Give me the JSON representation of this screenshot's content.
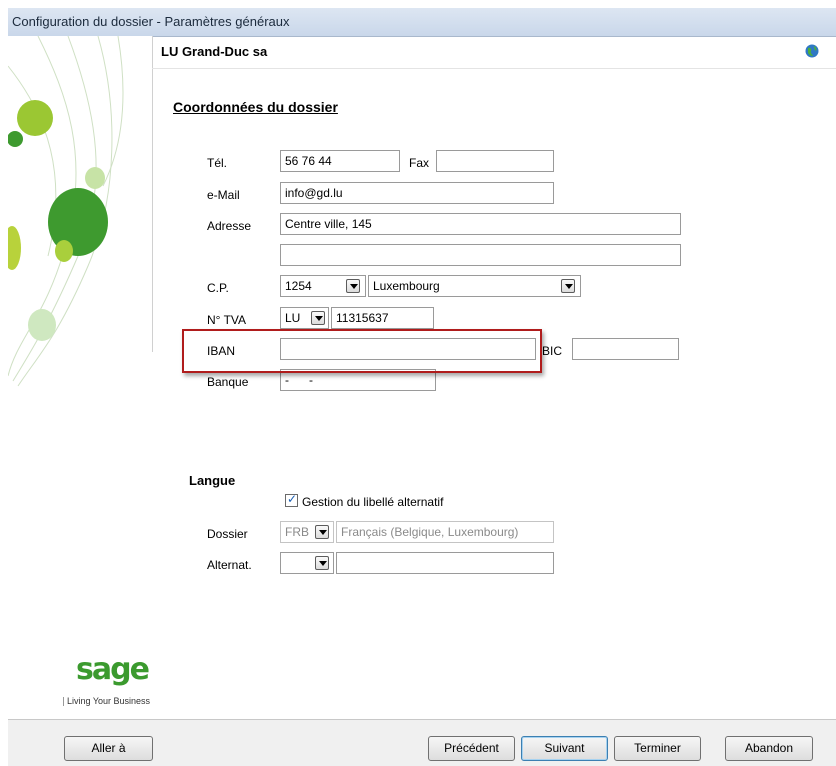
{
  "window": {
    "title": "Configuration du dossier - Paramètres généraux"
  },
  "header": {
    "company": "LU Grand-Duc sa",
    "icon": "globe-icon"
  },
  "coords": {
    "section_title": "Coordonnées du dossier",
    "tel_label": "Tél.",
    "tel_value": "56 76 44",
    "fax_label": "Fax",
    "fax_value": "",
    "email_label": "e-Mail",
    "email_value": "info@gd.lu",
    "adresse_label": "Adresse",
    "adresse_line1": "Centre ville, 145",
    "adresse_line2": "",
    "cp_label": "C.P.",
    "cp_value": "1254",
    "city_value": "Luxembourg",
    "tva_label": "N° TVA",
    "tva_country": "LU",
    "tva_number": "11315637",
    "iban_label": "IBAN",
    "iban_value": "",
    "bic_label": "BIC",
    "bic_value": "",
    "banque_label": "Banque",
    "banque_value": "-      -"
  },
  "langue": {
    "section_title": "Langue",
    "alt_checkbox_label": "Gestion du libellé alternatif",
    "alt_checkbox_checked": true,
    "dossier_label": "Dossier",
    "dossier_code": "FRB",
    "dossier_name": "Français (Belgique, Luxembourg)",
    "alternat_label": "Alternat.",
    "alternat_code": "",
    "alternat_name": ""
  },
  "branding": {
    "logo_text": "sage",
    "tagline": "Living Your Business",
    "logo_color": "#3b9a2e"
  },
  "footer": {
    "goto_label": "Aller à",
    "prev_label": "Précédent",
    "next_label": "Suivant",
    "finish_label": "Terminer",
    "cancel_label": "Abandon"
  },
  "colors": {
    "highlight": "#b01c1c",
    "title_bar": "#c9d7ea"
  }
}
